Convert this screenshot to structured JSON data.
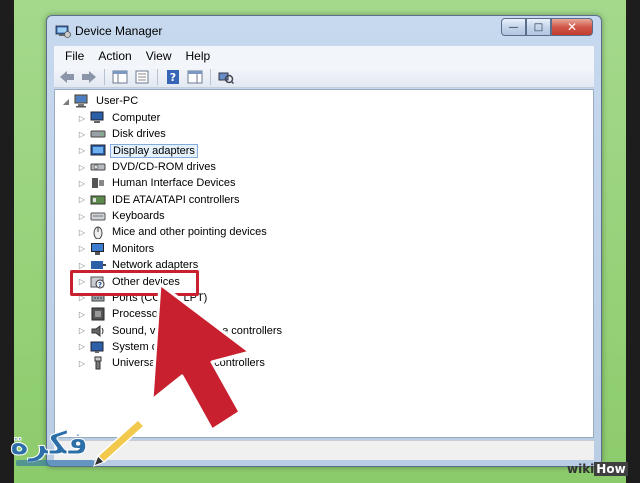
{
  "window": {
    "title": "Device Manager",
    "controls": {
      "minimize": "—",
      "maximize": "□",
      "close": "✕"
    }
  },
  "menu": [
    "File",
    "Action",
    "View",
    "Help"
  ],
  "toolbar": {
    "buttons": [
      "back-icon",
      "forward-icon",
      "show-hide-console-tree-icon",
      "properties-icon",
      "help-icon",
      "action-pane-icon",
      "scan-hardware-icon"
    ]
  },
  "tree": {
    "root": "User-PC",
    "items": [
      {
        "label": "Computer",
        "icon": "computer-icon"
      },
      {
        "label": "Disk drives",
        "icon": "disk-drive-icon"
      },
      {
        "label": "Display adapters",
        "icon": "display-adapter-icon",
        "selected": true
      },
      {
        "label": "DVD/CD-ROM drives",
        "icon": "dvd-drive-icon"
      },
      {
        "label": "Human Interface Devices",
        "icon": "hid-icon"
      },
      {
        "label": "IDE ATA/ATAPI controllers",
        "icon": "ide-controller-icon"
      },
      {
        "label": "Keyboards",
        "icon": "keyboard-icon"
      },
      {
        "label": "Mice and other pointing devices",
        "icon": "mouse-icon"
      },
      {
        "label": "Monitors",
        "icon": "monitor-icon"
      },
      {
        "label": "Network adapters",
        "icon": "network-adapter-icon"
      },
      {
        "label": "Other devices",
        "icon": "unknown-device-icon"
      },
      {
        "label": "Ports (COM & LPT)",
        "icon": "port-icon"
      },
      {
        "label": "Processors",
        "icon": "processor-icon"
      },
      {
        "label": "Sound, video and game controllers",
        "icon": "sound-icon"
      },
      {
        "label": "System devices",
        "icon": "system-device-icon"
      },
      {
        "label": "Universal Serial Bus controllers",
        "icon": "usb-icon"
      }
    ]
  },
  "overlay": {
    "highlight_color": "#c8202e",
    "arrow_color": "#c8202e",
    "watermark_logo": "فكرة",
    "watermark_site": "wikiHow",
    "wikihow_wiki": "wiki",
    "wikihow_how": "How"
  }
}
